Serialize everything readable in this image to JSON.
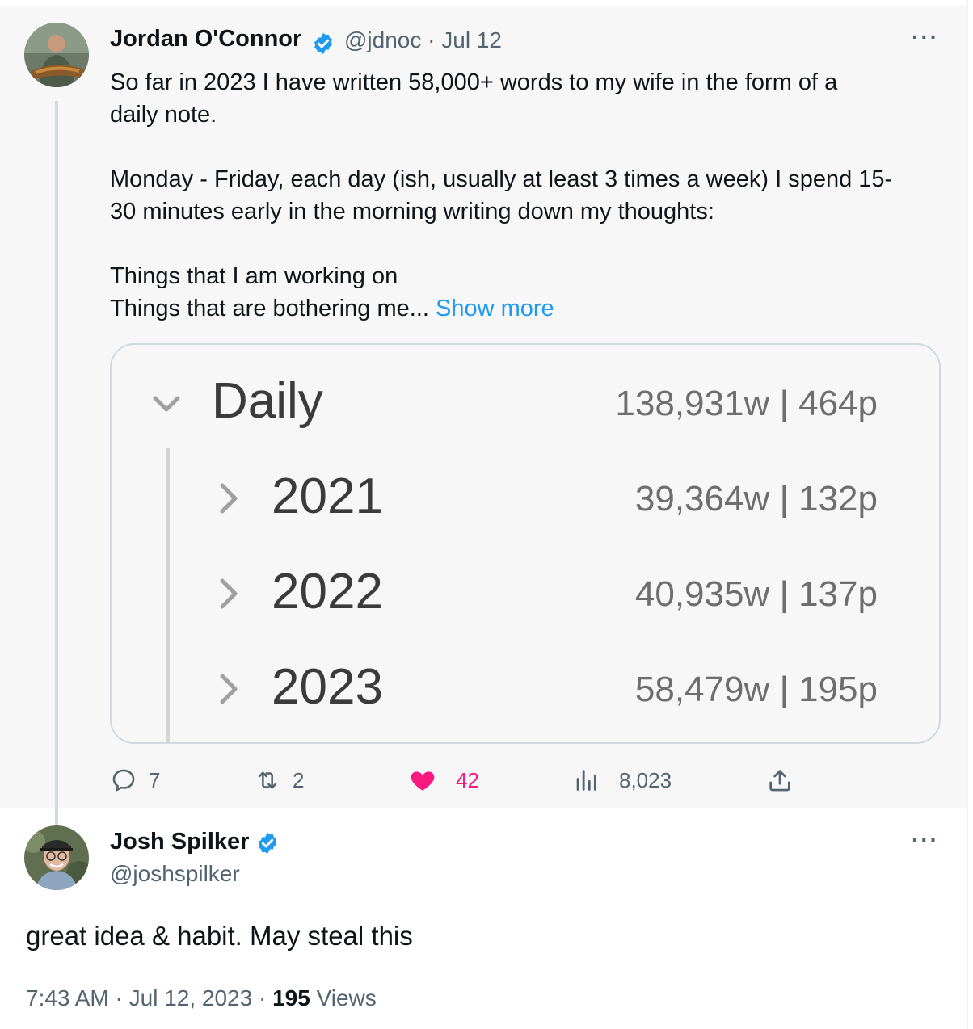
{
  "parent_tweet": {
    "author_name": "Jordan O'Connor",
    "handle": "@jdnoc",
    "separator": "·",
    "date": "Jul 12",
    "more_label": "···",
    "lines": [
      "So far in 2023 I have written 58,000+ words to my wife in the form of a",
      "daily note.",
      "",
      "Monday - Friday, each day (ish, usually at least 3 times a week) I spend 15-",
      "30 minutes early in the morning writing down my thoughts:",
      "",
      "Things that I am working on"
    ],
    "last_line": "Things that are bothering me...",
    "show_more": "Show more",
    "image": {
      "root": {
        "label": "Daily",
        "value": "138,931w | 464p"
      },
      "children": [
        {
          "label": "2021",
          "value": "39,364w | 132p"
        },
        {
          "label": "2022",
          "value": "40,935w | 137p"
        },
        {
          "label": "2023",
          "value": "58,479w | 195p"
        }
      ]
    },
    "actions": {
      "replies": "7",
      "retweets": "2",
      "likes": "42",
      "views": "8,023"
    },
    "colors": {
      "like": "#f91880",
      "link": "#1d9bf0",
      "verified": "#1d9bf0",
      "muted": "#536471"
    }
  },
  "reply_tweet": {
    "author_name": "Josh Spilker",
    "handle": "@joshspilker",
    "more_label": "···",
    "text": "great idea & habit. May steal this",
    "time": "7:43 AM",
    "sep1": "·",
    "date": "Jul 12, 2023",
    "sep2": "·",
    "views_count": "195",
    "views_label": "Views"
  }
}
